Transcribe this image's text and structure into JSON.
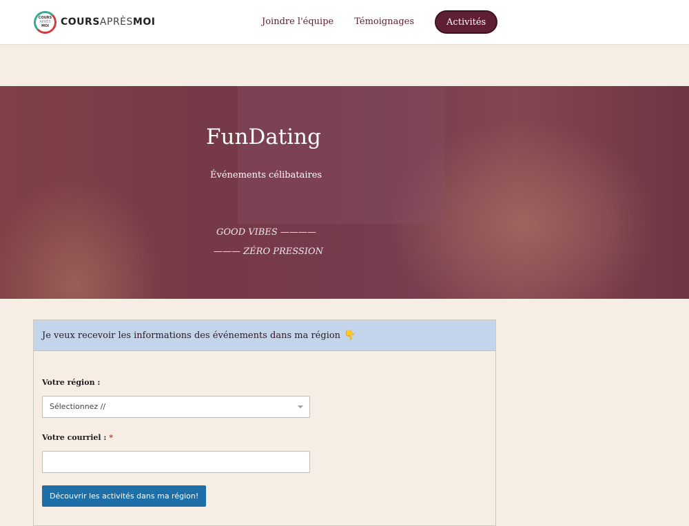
{
  "brand": {
    "logo_badge_lines": [
      "COURS",
      "APRÈS",
      "MOI"
    ],
    "logo_text_start": "COURS",
    "logo_text_mid": "APRÈS",
    "logo_text_end": "MOI"
  },
  "nav": {
    "items": [
      {
        "label": "Joindre l'équipe"
      },
      {
        "label": "Témoignages"
      }
    ],
    "cta_label": "Activités"
  },
  "hero": {
    "title": "FunDating",
    "subtitle": "Événements célibataires",
    "line1": "GOOD VIBES ————",
    "line2": "——— ZÉRO PRESSION"
  },
  "form": {
    "heading": "Je veux recevoir les informations des événements dans ma région",
    "heading_emoji": "👇",
    "region_label": "Votre région :",
    "region_selected": "Sélectionnez //",
    "email_label": "Votre courriel : ",
    "required_mark": "*",
    "email_value": "",
    "submit_label": "Découvrir les activités dans ma région!"
  },
  "colors": {
    "page_bg": "#f6ede4",
    "brand_maroon": "#5e1f33",
    "card_header": "#c3d5ea",
    "button_blue": "#1e6ea8"
  },
  "icons": {
    "select_caret": "chevron-down-icon"
  }
}
